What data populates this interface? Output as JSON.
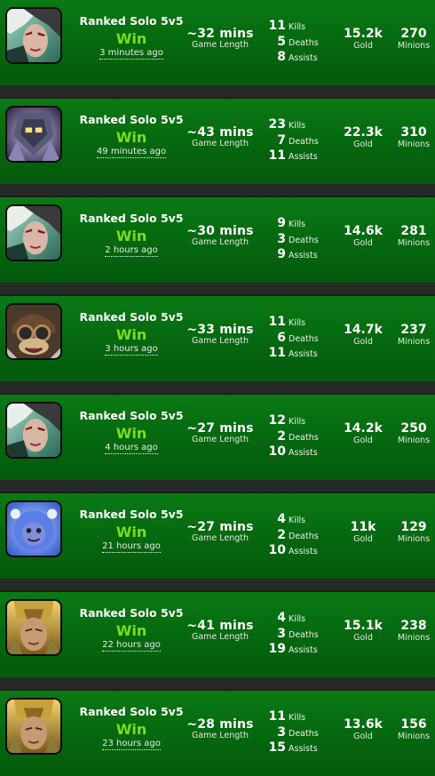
{
  "labels": {
    "game_length": "Game Length",
    "kills": "Kills",
    "deaths": "Deaths",
    "assists": "Assists",
    "gold": "Gold",
    "minions": "Minions"
  },
  "matches": [
    {
      "champion_icon": "champion-1-icon",
      "queue": "Ranked Solo 5v5",
      "result": "Win",
      "time_ago": "3 minutes ago",
      "length": "~32 mins",
      "kills": "11",
      "deaths": "5",
      "assists": "8",
      "gold": "15.2k",
      "minions": "270"
    },
    {
      "champion_icon": "champion-2-icon",
      "queue": "Ranked Solo 5v5",
      "result": "Win",
      "time_ago": "49 minutes ago",
      "length": "~43 mins",
      "kills": "23",
      "deaths": "7",
      "assists": "11",
      "gold": "22.3k",
      "minions": "310"
    },
    {
      "champion_icon": "champion-1-icon",
      "queue": "Ranked Solo 5v5",
      "result": "Win",
      "time_ago": "2 hours ago",
      "length": "~30 mins",
      "kills": "9",
      "deaths": "3",
      "assists": "9",
      "gold": "14.6k",
      "minions": "281"
    },
    {
      "champion_icon": "champion-3-icon",
      "queue": "Ranked Solo 5v5",
      "result": "Win",
      "time_ago": "3 hours ago",
      "length": "~33 mins",
      "kills": "11",
      "deaths": "6",
      "assists": "11",
      "gold": "14.7k",
      "minions": "237"
    },
    {
      "champion_icon": "champion-1-icon",
      "queue": "Ranked Solo 5v5",
      "result": "Win",
      "time_ago": "4 hours ago",
      "length": "~27 mins",
      "kills": "12",
      "deaths": "2",
      "assists": "10",
      "gold": "14.2k",
      "minions": "250"
    },
    {
      "champion_icon": "champion-4-icon",
      "queue": "Ranked Solo 5v5",
      "result": "Win",
      "time_ago": "21 hours ago",
      "length": "~27 mins",
      "kills": "4",
      "deaths": "2",
      "assists": "10",
      "gold": "11k",
      "minions": "129"
    },
    {
      "champion_icon": "champion-5-icon",
      "queue": "Ranked Solo 5v5",
      "result": "Win",
      "time_ago": "22 hours ago",
      "length": "~41 mins",
      "kills": "4",
      "deaths": "3",
      "assists": "19",
      "gold": "15.1k",
      "minions": "238"
    },
    {
      "champion_icon": "champion-5-icon",
      "queue": "Ranked Solo 5v5",
      "result": "Win",
      "time_ago": "23 hours ago",
      "length": "~28 mins",
      "kills": "11",
      "deaths": "3",
      "assists": "15",
      "gold": "13.6k",
      "minions": "156"
    }
  ]
}
